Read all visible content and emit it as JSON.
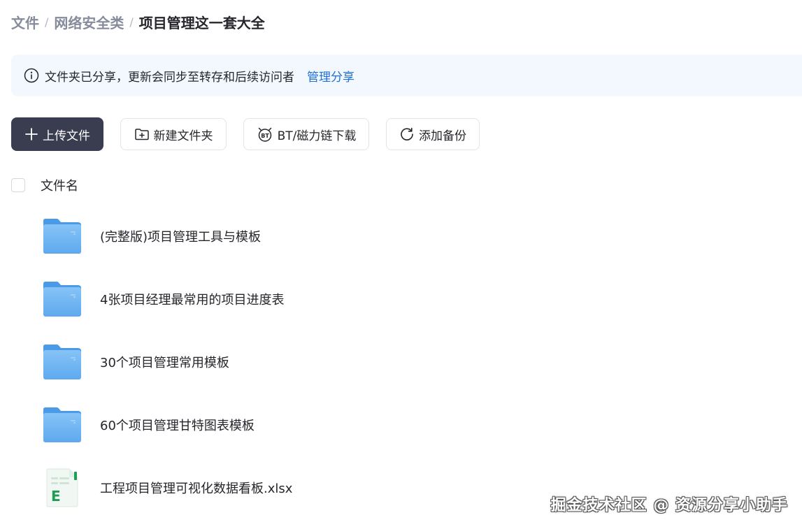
{
  "breadcrumb": {
    "items": [
      "文件",
      "网络安全类"
    ],
    "separator": "/",
    "current": "项目管理这一套大全"
  },
  "notice": {
    "icon": "info-icon",
    "text": "文件夹已分享，更新会同步至转存和后续访问者",
    "link": "管理分享"
  },
  "toolbar": {
    "upload_label": "上传文件",
    "new_folder_label": "新建文件夹",
    "bt_label": "BT/磁力链下载",
    "backup_label": "添加备份"
  },
  "list": {
    "header_label": "文件名",
    "files": [
      {
        "name": "(完整版)项目管理工具与模板",
        "type": "folder"
      },
      {
        "name": "4张项目经理最常用的项目进度表",
        "type": "folder"
      },
      {
        "name": "30个项目管理常用模板",
        "type": "folder"
      },
      {
        "name": "60个项目管理甘特图表模板",
        "type": "folder"
      },
      {
        "name": "工程项目管理可视化数据看板.xlsx",
        "type": "xlsx"
      }
    ]
  },
  "watermark": "掘金技术社区 @ 资源分享小助手",
  "colors": {
    "primary_button": "#3a3d4f",
    "link": "#1e6fd9",
    "notice_bg": "#f2f8fd",
    "folder": "#5aa8f0",
    "excel": "#1f9d55"
  }
}
